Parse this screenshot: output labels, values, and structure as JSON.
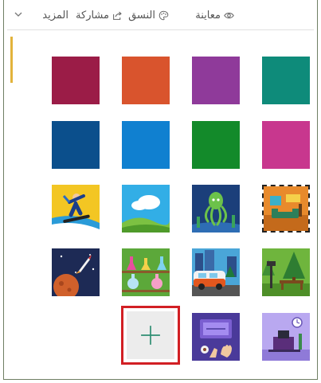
{
  "toolbar": {
    "preview_label": "معاينة",
    "theme_label": "النسق",
    "share_label": "مشاركة",
    "more_label": "المزيد"
  },
  "colors": {
    "swatch_1": "#9b1c47",
    "swatch_2": "#d9542d",
    "swatch_3": "#8f3a9a",
    "swatch_4": "#0e8b7a",
    "swatch_5": "#0b4f8c",
    "swatch_6": "#1080d0",
    "swatch_7": "#138a2a",
    "swatch_8": "#c8378e",
    "add_highlight": "#d21f24"
  },
  "images": [
    {
      "name": "snowboarder-image"
    },
    {
      "name": "clouds-landscape-image"
    },
    {
      "name": "octopus-image"
    },
    {
      "name": "room-stamp-image"
    },
    {
      "name": "space-rocket-image"
    },
    {
      "name": "lab-flasks-image"
    },
    {
      "name": "city-van-image"
    },
    {
      "name": "forest-bench-image"
    },
    {
      "name": "tablet-hands-image"
    },
    {
      "name": "desk-clock-image"
    }
  ],
  "add_button": {
    "icon": "plus-icon"
  }
}
